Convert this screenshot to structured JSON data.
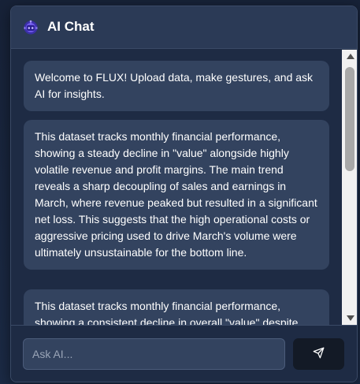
{
  "header": {
    "title": "AI Chat",
    "logo_icon": "robot-icon"
  },
  "messages": [
    {
      "text": "Welcome to FLUX! Upload data, make gestures, and ask AI for insights."
    },
    {
      "text": "This dataset tracks monthly financial performance, showing a steady decline in \"value\" alongside highly volatile revenue and profit margins. The main trend reveals a sharp decoupling of sales and earnings in March, where revenue peaked but resulted in a significant net loss. This suggests that the high operational costs or aggressive pricing used to drive March's volume were ultimately unsustainable for the bottom line."
    },
    {
      "text": "This dataset tracks monthly financial performance, showing a consistent decline in overall \"value\" despite"
    }
  ],
  "input": {
    "placeholder": "Ask AI...",
    "value": ""
  },
  "send_icon": "send-icon",
  "colors": {
    "header_bg": "#2b3a56",
    "panel_bg": "#1e2b44",
    "bubble_bg": "#33435f",
    "send_button_bg": "#131a26",
    "logo_color": "#6f58e8"
  }
}
